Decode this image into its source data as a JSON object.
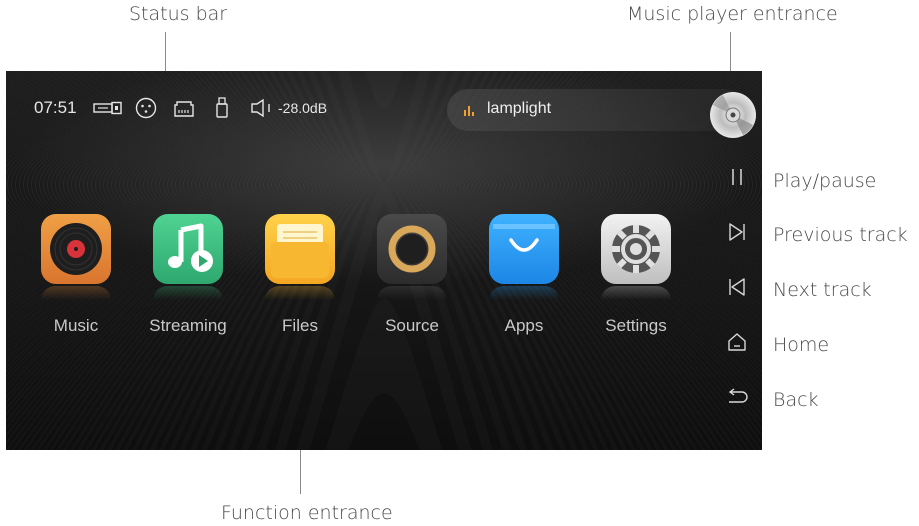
{
  "annotations": {
    "status_bar": "Status bar",
    "music_player_entrance": "Music player entrance",
    "function_entrance": "Function entrance",
    "play_pause": "Play/pause",
    "previous_track": "Previous track",
    "next_track": "Next track",
    "home": "Home",
    "back": "Back"
  },
  "status_bar": {
    "time": "07:51",
    "volume": "-28.0dB",
    "icons": [
      "usb-dac-output-icon",
      "xlr-balanced-icon",
      "ethernet-icon",
      "usb-drive-icon",
      "speaker-icon"
    ]
  },
  "now_playing": {
    "title": "lamplight",
    "icon": "equalizer-bars-icon"
  },
  "apps": [
    {
      "label": "Music",
      "icon": "vinyl-record-icon",
      "color": "#e58a3c"
    },
    {
      "label": "Streaming",
      "icon": "music-note-play-icon",
      "color": "#3fbf84"
    },
    {
      "label": "Files",
      "icon": "folder-icon",
      "color": "#f7b731"
    },
    {
      "label": "Source",
      "icon": "input-ring-icon",
      "color": "#3c3c3c"
    },
    {
      "label": "Apps",
      "icon": "shopping-bag-icon",
      "color": "#2a9df4"
    },
    {
      "label": "Settings",
      "icon": "gear-icon",
      "color": "#d8d8d8"
    }
  ],
  "side_controls": [
    "pause-icon",
    "skip-icon",
    "skip-back-icon",
    "home-icon",
    "back-arrow-icon"
  ],
  "colors": {
    "screen_bg": "#161616",
    "accent_eq": "#f0a030",
    "label": "#c9c9c9"
  }
}
